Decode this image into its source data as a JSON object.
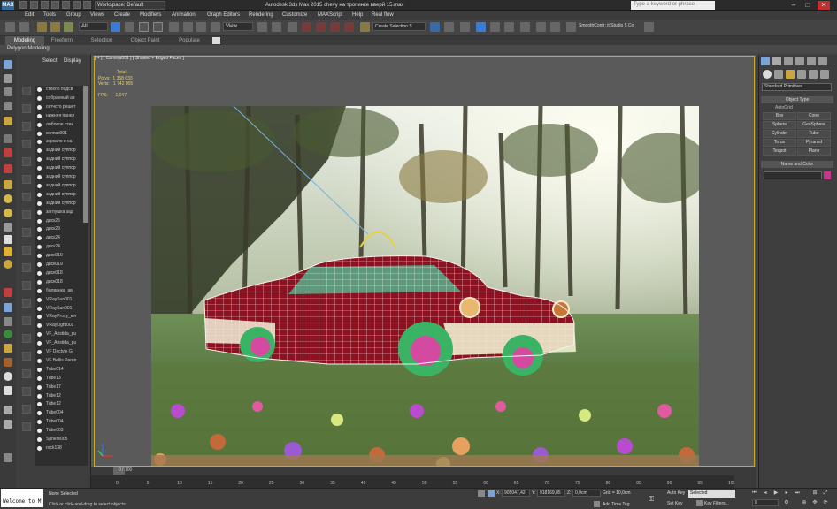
{
  "titlebar": {
    "workspace": "Workspace: Default",
    "title": "Autodesk 3ds Max 2015    chevy  на тропинке вверй 15.max",
    "search_placeholder": "Type a keyword or phrase"
  },
  "menu": [
    "Edit",
    "Tools",
    "Group",
    "Views",
    "Create",
    "Modifiers",
    "Animation",
    "Graph Editors",
    "Rendering",
    "Customize",
    "MAXScript",
    "Help",
    "Real flow"
  ],
  "toolbar": {
    "selection_filter": "All",
    "reference_coord": "View",
    "named_selection": "Create Selection S",
    "smoothcontrol": "SmoothContr: it Studio 5 Co"
  },
  "ribbon": {
    "tabs": [
      "Modeling",
      "Freeform",
      "Selection",
      "Object Paint",
      "Populate"
    ],
    "panel_label": "Polygon Modeling"
  },
  "explorer": {
    "tabs": [
      "Select",
      "Display"
    ],
    "items": [
      "стекло подсв",
      "собранный ав",
      "сетчсто решет",
      "нижняя панел",
      "лобовое стек",
      "колпак001",
      "зеркало в са",
      "задний суппор",
      "задний суппор",
      "задний суппор",
      "задний суппор",
      "задний суппор",
      "задний суппор",
      "задний суппор",
      "заглушка зад",
      "диск25",
      "диск29",
      "диск24",
      "диск24",
      "диск019",
      "диск019",
      "диск018",
      "диск018",
      "болванка_ав",
      "VRaySun001",
      "VRaySun001",
      "VRayProxy_мя",
      "VRayLight002",
      "VF_Aristida_pu",
      "VF_Aristida_pu",
      "VF Dactyle Gl",
      "VF Bellis Peren",
      "Tube014",
      "Tube13",
      "Tube17",
      "Tube12",
      "Tube12",
      "Tube004",
      "Tube004",
      "Tube003",
      "Sphere005",
      "rock138"
    ]
  },
  "viewport": {
    "label": "[ + ] [ Camera001 ] [ Shaded + Edged Faces ]",
    "stats": {
      "total_label": "Total",
      "polys_label": "Polys:",
      "polys": "1 358 633",
      "verts_label": "Verts:",
      "verts": "1 742 005",
      "fps_label": "FPS:",
      "fps": "1,047"
    }
  },
  "command_panel": {
    "category": "Standard Primitives",
    "object_type": "Object Type",
    "autogrid": "AutoGrid",
    "buttons": [
      "Box",
      "Cone",
      "Sphere",
      "GeoSphere",
      "Cylinder",
      "Tube",
      "Torus",
      "Pyramid",
      "Teapot",
      "Plane"
    ],
    "name_color": "Name and Color",
    "color": "#c03a8a"
  },
  "timeline": {
    "frame_counter": "0 / 100",
    "ticks": [
      "0",
      "5",
      "10",
      "15",
      "20",
      "25",
      "30",
      "35",
      "40",
      "45",
      "50",
      "55",
      "60",
      "65",
      "70",
      "75",
      "80",
      "85",
      "90",
      "95",
      "100"
    ]
  },
  "status": {
    "maxscript": "Welcome to M",
    "selection": "None Selected",
    "prompt": "Click or click-and-drag to select objects",
    "x_label": "X:",
    "x": "905047,42",
    "y_label": "Y:",
    "y": "918169,85",
    "z_label": "Z:",
    "z": "0,0cm",
    "grid": "Grid = 10,0cm",
    "add_time_tag": "Add Time Tag",
    "auto_key": "Auto Key",
    "set_key": "Set Key",
    "selected": "Selected",
    "key_filters": "Key Filters...",
    "frame": "0"
  }
}
